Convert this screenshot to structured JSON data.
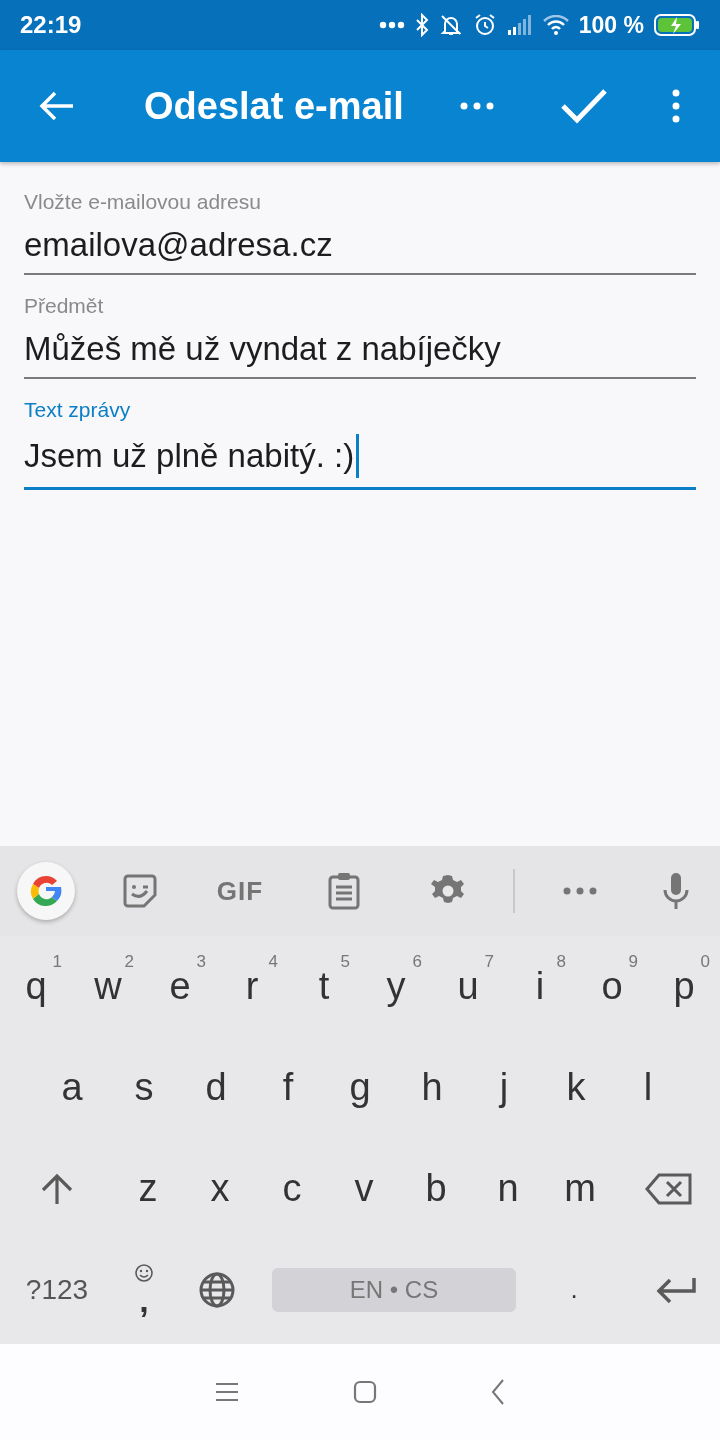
{
  "status_bar": {
    "time": "22:19",
    "battery": "100 %"
  },
  "app_bar": {
    "title": "Odeslat e-mail"
  },
  "fields": [
    {
      "label": "Vložte e-mailovou adresu",
      "value": "emailova@adresa.cz",
      "focused": false
    },
    {
      "label": "Předmět",
      "value": "Můžeš mě už vyndat z nabíječky",
      "focused": false
    },
    {
      "label": "Text zprávy",
      "value": "Jsem už plně nabitý. :)",
      "focused": true
    }
  ],
  "keyboard": {
    "toolbar": {
      "gif": "GIF"
    },
    "rows": [
      [
        {
          "kind": "letter",
          "label": "q",
          "hint": "1"
        },
        {
          "kind": "letter",
          "label": "w",
          "hint": "2"
        },
        {
          "kind": "letter",
          "label": "e",
          "hint": "3"
        },
        {
          "kind": "letter",
          "label": "r",
          "hint": "4"
        },
        {
          "kind": "letter",
          "label": "t",
          "hint": "5"
        },
        {
          "kind": "letter",
          "label": "y",
          "hint": "6"
        },
        {
          "kind": "letter",
          "label": "u",
          "hint": "7"
        },
        {
          "kind": "letter",
          "label": "i",
          "hint": "8"
        },
        {
          "kind": "letter",
          "label": "o",
          "hint": "9"
        },
        {
          "kind": "letter",
          "label": "p",
          "hint": "0"
        }
      ],
      [
        {
          "kind": "letter",
          "label": "a"
        },
        {
          "kind": "letter",
          "label": "s"
        },
        {
          "kind": "letter",
          "label": "d"
        },
        {
          "kind": "letter",
          "label": "f"
        },
        {
          "kind": "letter",
          "label": "g"
        },
        {
          "kind": "letter",
          "label": "h"
        },
        {
          "kind": "letter",
          "label": "j"
        },
        {
          "kind": "letter",
          "label": "k"
        },
        {
          "kind": "letter",
          "label": "l"
        }
      ],
      [
        {
          "kind": "shift"
        },
        {
          "kind": "letter",
          "label": "z"
        },
        {
          "kind": "letter",
          "label": "x"
        },
        {
          "kind": "letter",
          "label": "c"
        },
        {
          "kind": "letter",
          "label": "v"
        },
        {
          "kind": "letter",
          "label": "b"
        },
        {
          "kind": "letter",
          "label": "n"
        },
        {
          "kind": "letter",
          "label": "m"
        },
        {
          "kind": "backspace"
        }
      ]
    ],
    "bottom_row": [
      {
        "kind": "symbols",
        "label": "?123"
      },
      {
        "kind": "comma",
        "label": ","
      },
      {
        "kind": "globe"
      },
      {
        "kind": "space",
        "label": "EN • CS"
      },
      {
        "kind": "period",
        "label": "."
      },
      {
        "kind": "enter"
      }
    ]
  }
}
